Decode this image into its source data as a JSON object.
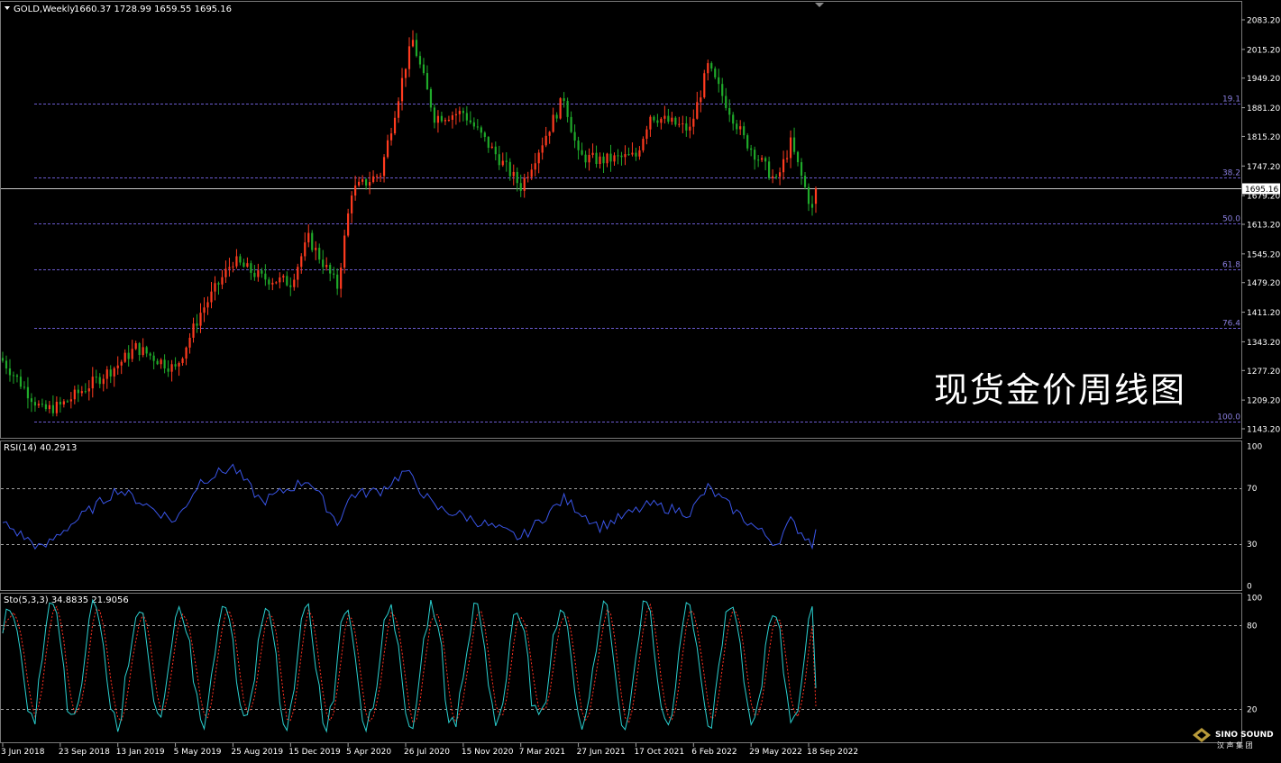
{
  "main": {
    "symbol": "GOLD,Weekly",
    "ohlc": "1660.37 1728.99 1659.55 1695.16",
    "current_price": "1695.16",
    "price_ticks": [
      "2083.20",
      "2015.20",
      "1949.20",
      "1881.20",
      "1815.20",
      "1747.20",
      "1679.20",
      "1613.20",
      "1545.20",
      "1479.20",
      "1411.20",
      "1343.20",
      "1277.20",
      "1209.20",
      "1143.20"
    ],
    "fib_levels": [
      {
        "label": "19.1",
        "price": 1891
      },
      {
        "label": "38.2",
        "price": 1720
      },
      {
        "label": "50.0",
        "price": 1616
      },
      {
        "label": "61.8",
        "price": 1510
      },
      {
        "label": "76.4",
        "price": 1376
      },
      {
        "label": "100.0",
        "price": 1160
      }
    ],
    "watermark": "现货金价周线图"
  },
  "rsi": {
    "title": "RSI(14) 40.2913",
    "ticks": [
      "100",
      "70",
      "30",
      "0"
    ],
    "levels": [
      70,
      30
    ]
  },
  "sto": {
    "title": "Sto(5,3,3) 34.8835 21.9056",
    "ticks": [
      "100",
      "80",
      "20"
    ],
    "levels": [
      80,
      20
    ]
  },
  "x_axis": {
    "labels": [
      "3 Jun 2018",
      "23 Sep 2018",
      "13 Jan 2019",
      "5 May 2019",
      "25 Aug 2019",
      "15 Dec 2019",
      "5 Apr 2020",
      "26 Jul 2020",
      "15 Nov 2020",
      "7 Mar 2021",
      "27 Jun 2021",
      "17 Oct 2021",
      "6 Feb 2022",
      "29 May 2022",
      "18 Sep 2022"
    ]
  },
  "logo": {
    "line1": "SINO SOUND",
    "line2": "汉 声 集 团"
  },
  "colors": {
    "background": "#000000",
    "bull_candle": "#ff3b1f",
    "bear_candle": "#1faa2a",
    "wick": "#c0c0c0",
    "fib_line": "#6a5acd",
    "fib_label": "#8a7fe0",
    "rsi_line": "#3a55e8",
    "sto_main": "#2ad0d0",
    "sto_signal": "#ff3020",
    "axis_text": "#ffffff",
    "grid_dash": "#a0a0a0",
    "price_line": "#c8c8c8"
  },
  "chart_data": [
    {
      "type": "candlestick",
      "title": "GOLD,Weekly",
      "ylim": [
        1143.2,
        2083.2
      ],
      "x_start": "2018-06-03",
      "x_end": "2022-10-02",
      "weekly_closes_anchors": [
        {
          "date": "2018-06-03",
          "close": 1300
        },
        {
          "date": "2018-08-19",
          "close": 1185
        },
        {
          "date": "2018-09-23",
          "close": 1196
        },
        {
          "date": "2019-01-13",
          "close": 1290
        },
        {
          "date": "2019-02-17",
          "close": 1330
        },
        {
          "date": "2019-05-05",
          "close": 1280
        },
        {
          "date": "2019-06-23",
          "close": 1410
        },
        {
          "date": "2019-08-25",
          "close": 1530
        },
        {
          "date": "2019-10-20",
          "close": 1490
        },
        {
          "date": "2019-12-15",
          "close": 1480
        },
        {
          "date": "2020-01-19",
          "close": 1580
        },
        {
          "date": "2020-03-15",
          "close": 1470
        },
        {
          "date": "2020-04-12",
          "close": 1690
        },
        {
          "date": "2020-06-07",
          "close": 1730
        },
        {
          "date": "2020-07-26",
          "close": 1980
        },
        {
          "date": "2020-08-09",
          "close": 2035
        },
        {
          "date": "2020-09-20",
          "close": 1860
        },
        {
          "date": "2020-11-15",
          "close": 1870
        },
        {
          "date": "2021-03-07",
          "close": 1700
        },
        {
          "date": "2021-05-30",
          "close": 1905
        },
        {
          "date": "2021-06-27",
          "close": 1770
        },
        {
          "date": "2021-08-08",
          "close": 1760
        },
        {
          "date": "2021-10-17",
          "close": 1770
        },
        {
          "date": "2021-11-14",
          "close": 1865
        },
        {
          "date": "2022-01-30",
          "close": 1830
        },
        {
          "date": "2022-03-06",
          "close": 1975
        },
        {
          "date": "2022-05-15",
          "close": 1810
        },
        {
          "date": "2022-07-17",
          "close": 1710
        },
        {
          "date": "2022-08-14",
          "close": 1800
        },
        {
          "date": "2022-09-25",
          "close": 1645
        },
        {
          "date": "2022-10-02",
          "close": 1695.16
        }
      ]
    },
    {
      "type": "line",
      "title": "RSI(14) 40.2913",
      "ylim": [
        0,
        100
      ],
      "levels": [
        70,
        30
      ],
      "anchors": [
        {
          "date": "2018-06-03",
          "value": 45
        },
        {
          "date": "2018-08-19",
          "value": 26
        },
        {
          "date": "2018-09-23",
          "value": 38
        },
        {
          "date": "2019-01-13",
          "value": 69
        },
        {
          "date": "2019-02-17",
          "value": 62
        },
        {
          "date": "2019-05-05",
          "value": 46
        },
        {
          "date": "2019-06-23",
          "value": 75
        },
        {
          "date": "2019-08-25",
          "value": 85
        },
        {
          "date": "2019-10-20",
          "value": 60
        },
        {
          "date": "2019-12-15",
          "value": 70
        },
        {
          "date": "2020-01-19",
          "value": 76
        },
        {
          "date": "2020-03-15",
          "value": 45
        },
        {
          "date": "2020-04-12",
          "value": 65
        },
        {
          "date": "2020-06-07",
          "value": 68
        },
        {
          "date": "2020-07-26",
          "value": 82
        },
        {
          "date": "2020-09-20",
          "value": 56
        },
        {
          "date": "2020-11-15",
          "value": 50
        },
        {
          "date": "2021-03-07",
          "value": 34
        },
        {
          "date": "2021-05-30",
          "value": 62
        },
        {
          "date": "2021-08-08",
          "value": 42
        },
        {
          "date": "2021-11-14",
          "value": 58
        },
        {
          "date": "2022-01-30",
          "value": 52
        },
        {
          "date": "2022-03-06",
          "value": 70
        },
        {
          "date": "2022-05-15",
          "value": 48
        },
        {
          "date": "2022-07-17",
          "value": 30
        },
        {
          "date": "2022-08-14",
          "value": 46
        },
        {
          "date": "2022-09-25",
          "value": 30
        },
        {
          "date": "2022-10-02",
          "value": 40.29
        }
      ]
    },
    {
      "type": "line",
      "title": "Sto(5,3,3) 34.8835 21.9056",
      "ylim": [
        0,
        100
      ],
      "levels": [
        80,
        20
      ],
      "series": [
        {
          "name": "main",
          "last": 34.8835
        },
        {
          "name": "signal",
          "last": 21.9056
        }
      ]
    }
  ]
}
